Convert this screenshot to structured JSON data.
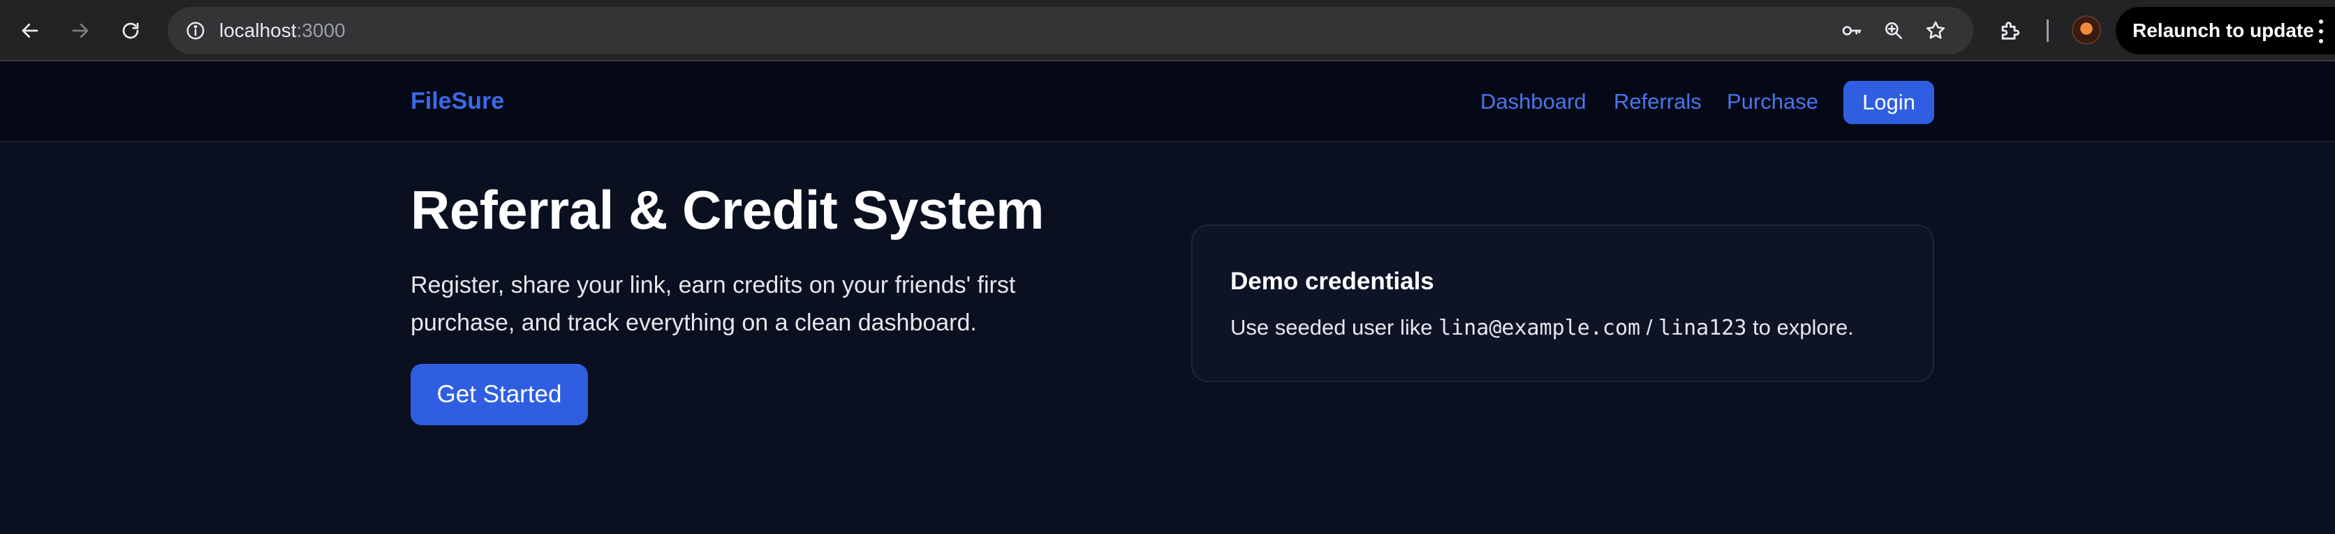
{
  "browser": {
    "url_host": "localhost",
    "url_port": ":3000",
    "relaunch_label": "Relaunch to update",
    "icons": [
      "back-icon",
      "forward-icon",
      "reload-icon",
      "site-info-icon",
      "password-key-icon",
      "zoom-icon",
      "bookmark-star-icon",
      "extensions-icon",
      "profile-avatar",
      "more-menu-icon"
    ]
  },
  "header": {
    "brand": "FileSure",
    "nav": [
      "Dashboard",
      "Referrals",
      "Purchase"
    ],
    "login_label": "Login"
  },
  "hero": {
    "title": "Referral & Credit System",
    "description": "Register, share your link, earn credits on your friends' first purchase, and track everything on a clean dashboard.",
    "cta_label": "Get Started"
  },
  "demo_card": {
    "title": "Demo credentials",
    "text_prefix": "Use seeded user like",
    "email": "lina@example.com",
    "separator": "/",
    "password": "lina123",
    "text_suffix": "to explore."
  },
  "colors": {
    "page_bg": "#0b1020",
    "header_bg": "#050917",
    "accent": "#2f5fe0",
    "link": "#4a76ea"
  }
}
